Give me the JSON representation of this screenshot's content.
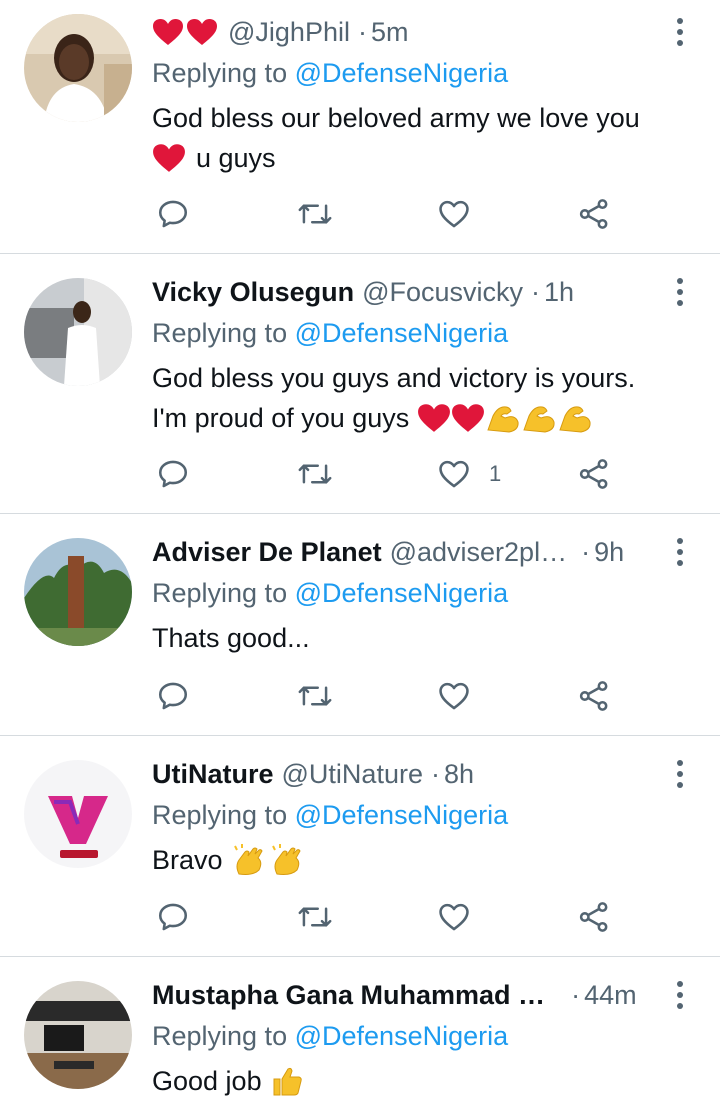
{
  "replying_prefix": "Replying to",
  "tweets": [
    {
      "name": "",
      "handle": "@JighPhil",
      "time": "5m",
      "name_prefix_emoji": [
        "red-heart",
        "red-heart"
      ],
      "replying_to": "@DefenseNigeria",
      "text_lines": [
        "God bless our beloved army we love you",
        "u guys"
      ],
      "like_count": ""
    },
    {
      "name": "Vicky Olusegun",
      "handle": "@Focusvicky",
      "time": "1h",
      "replying_to": "@DefenseNigeria",
      "text_lines": [
        "God bless you guys and victory is yours.",
        "I'm proud of you guys"
      ],
      "like_count": "1"
    },
    {
      "name": "Adviser De Planet",
      "handle": "@adviser2pl…",
      "time": "9h",
      "replying_to": "@DefenseNigeria",
      "text_lines": [
        "Thats good..."
      ],
      "like_count": ""
    },
    {
      "name": "UtiNature",
      "handle": "@UtiNature",
      "time": "8h",
      "replying_to": "@DefenseNigeria",
      "text_lines": [
        "Bravo"
      ],
      "like_count": ""
    },
    {
      "name": "Mustapha Gana Muhammad …",
      "handle": "",
      "time": "44m",
      "replying_to": "@DefenseNigeria",
      "text_lines": [
        "Good job"
      ],
      "like_count": ""
    }
  ],
  "icons": {
    "reply": "reply-icon",
    "retweet": "retweet-icon",
    "like": "like-icon",
    "share": "share-icon",
    "more": "more-icon"
  },
  "colors": {
    "text": "#0f1419",
    "secondary": "#536471",
    "link": "#1d9bf0",
    "heart": "#e0163a",
    "divider": "#d6dbdf"
  }
}
